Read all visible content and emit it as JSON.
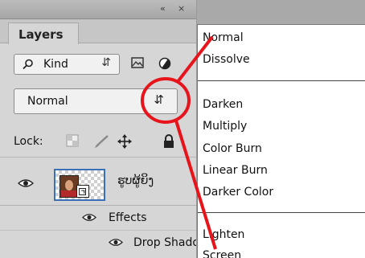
{
  "titlebar": {
    "collapse_label": "«",
    "close_label": "×"
  },
  "panel": {
    "tab_label": "Layers",
    "kind_filter": {
      "value": "Kind"
    },
    "blend_mode": {
      "value": "Normal"
    },
    "lock_label": "Lock:",
    "layers": [
      {
        "name": "ຮູບຜູ້ຍິງ"
      },
      {
        "name": "Effects"
      },
      {
        "name": "Drop Shadow"
      }
    ]
  },
  "menu": {
    "groups": [
      [
        "Normal",
        "Dissolve"
      ],
      [
        "Darken",
        "Multiply",
        "Color Burn",
        "Linear Burn",
        "Darker Color"
      ],
      [
        "Lighten",
        "Screen"
      ]
    ]
  },
  "colors": {
    "annotation": "#e8141b",
    "selection_border": "#3b6fb6",
    "panel_bg": "#d6d6d6"
  }
}
